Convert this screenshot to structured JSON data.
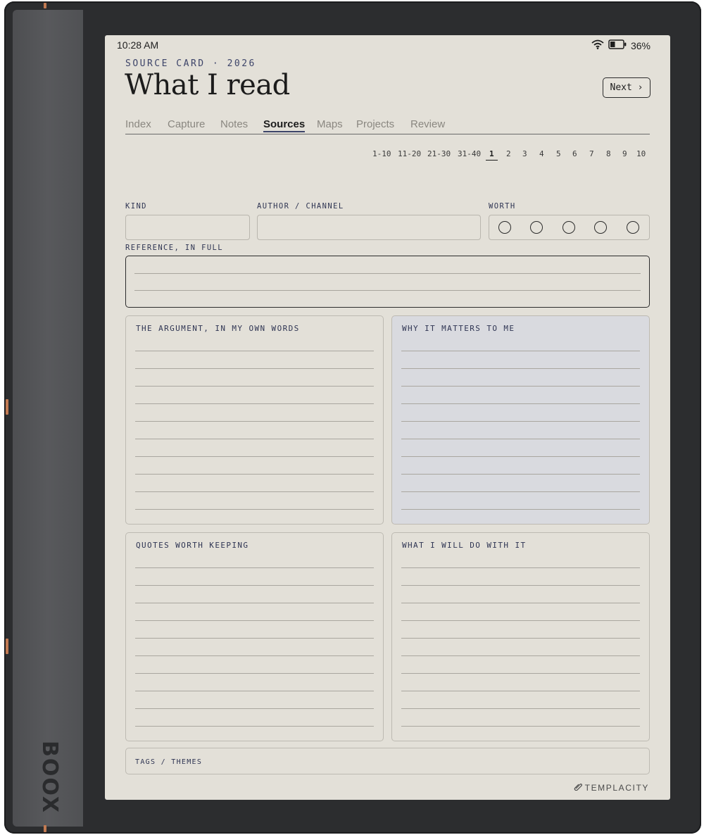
{
  "device": {
    "brand": "BOOX"
  },
  "status_bar": {
    "time": "10:28 AM",
    "battery": "36%"
  },
  "header": {
    "kicker": "SOURCE CARD · 2026",
    "title": "What I read",
    "next_label": "Next ›"
  },
  "tabs": [
    "Index",
    "Capture",
    "Notes",
    "Sources",
    "Maps",
    "Projects",
    "Review"
  ],
  "active_tab": "Sources",
  "pager": {
    "ranges": [
      "1-10",
      "11-20",
      "21-30",
      "31-40"
    ],
    "pages": [
      "1",
      "2",
      "3",
      "4",
      "5",
      "6",
      "7",
      "8",
      "9",
      "10"
    ],
    "current": "1"
  },
  "fields": {
    "kind": "KIND",
    "author": "AUTHOR / CHANNEL",
    "worth": "WORTH",
    "reference": "REFERENCE, IN FULL"
  },
  "panels": {
    "argument": "THE ARGUMENT, IN MY OWN WORDS",
    "why": "WHY IT MATTERS TO ME",
    "quotes": "QUOTES WORTH KEEPING",
    "action": "WHAT I WILL DO WITH IT",
    "tags": "TAGS / THEMES"
  },
  "footer": {
    "wordmark": "TEMPLACITY"
  },
  "colors": {
    "screen": "#e3e0d8",
    "accent_ink": "#3d4469",
    "tinted_panel": "#d9dadf",
    "frame": "#2c2d2f",
    "copper": "#c27a52"
  }
}
